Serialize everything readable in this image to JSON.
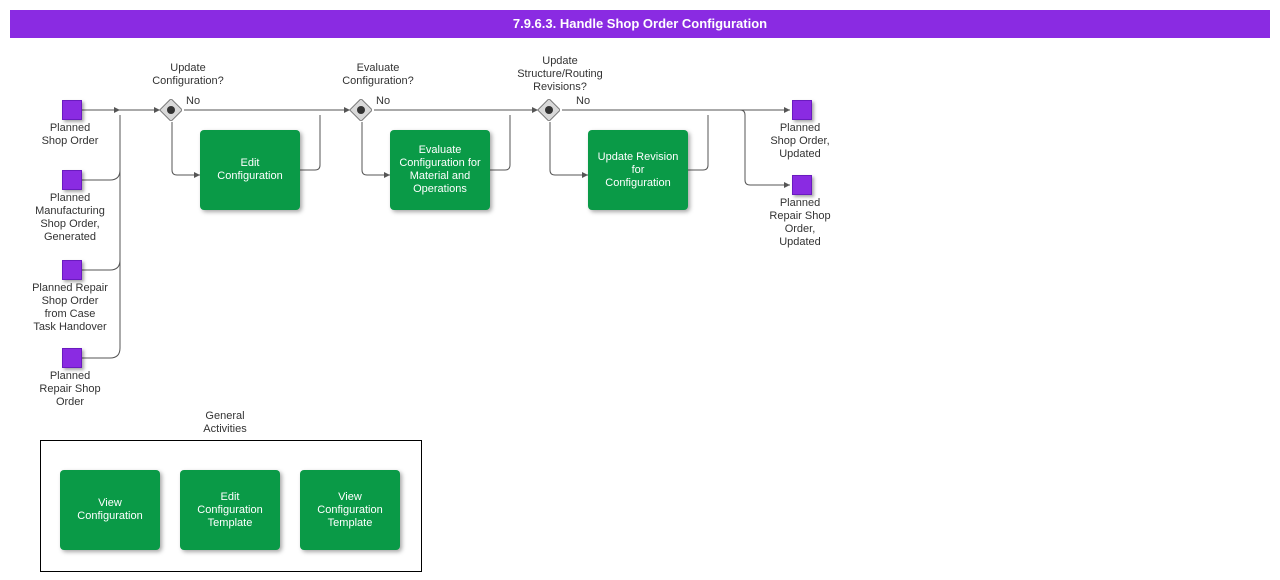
{
  "title": "7.9.6.3. Handle Shop Order Configuration",
  "starts": [
    {
      "label": "Planned\nShop Order"
    },
    {
      "label": "Planned\nManufacturing\nShop Order,\nGenerated"
    },
    {
      "label": "Planned Repair\nShop Order\nfrom Case\nTask Handover"
    },
    {
      "label": "Planned\nRepair Shop\nOrder"
    }
  ],
  "gateways": [
    {
      "label": "Update\nConfiguration?",
      "no": "No"
    },
    {
      "label": "Evaluate\nConfiguration?",
      "no": "No"
    },
    {
      "label": "Update\nStructure/Routing\nRevisions?",
      "no": "No"
    }
  ],
  "tasks": [
    {
      "label": "Edit\nConfiguration"
    },
    {
      "label": "Evaluate\nConfiguration for\nMaterial and\nOperations"
    },
    {
      "label": "Update Revision\nfor\nConfiguration"
    }
  ],
  "ends": [
    {
      "label": "Planned\nShop Order,\nUpdated"
    },
    {
      "label": "Planned\nRepair Shop\nOrder,\nUpdated"
    }
  ],
  "general_activities": {
    "title": "General\nActivities",
    "items": [
      {
        "label": "View\nConfiguration"
      },
      {
        "label": "Edit\nConfiguration\nTemplate"
      },
      {
        "label": "View\nConfiguration\nTemplate"
      }
    ]
  }
}
